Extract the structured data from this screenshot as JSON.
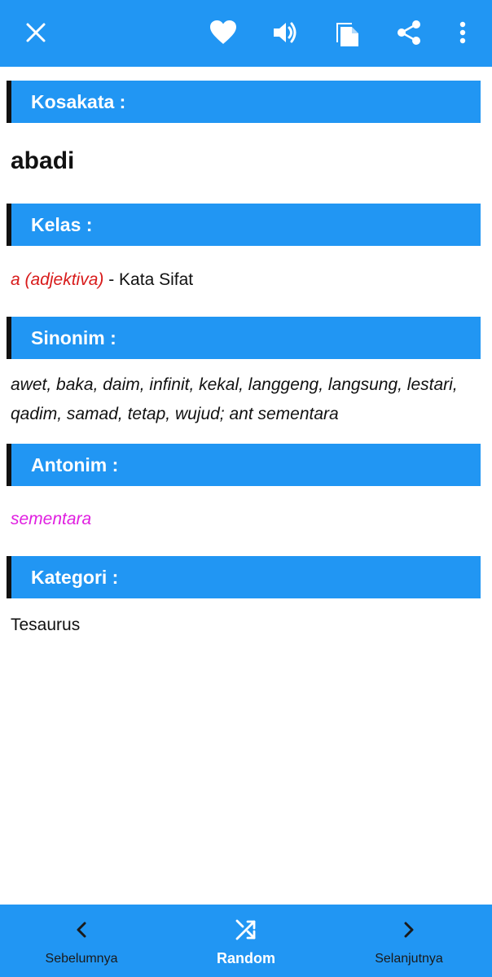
{
  "toolbar": {
    "icons": [
      "close-icon",
      "heart-icon",
      "volume-icon",
      "copy-icon",
      "share-icon",
      "more-vert-icon"
    ],
    "color": "#2196F3"
  },
  "sections": {
    "kosakata": {
      "header": "Kosakata :",
      "value": "abadi"
    },
    "kelas": {
      "header": "Kelas :",
      "class_abbr": "a (adjektiva)",
      "class_desc": " - Kata Sifat"
    },
    "sinonim": {
      "header": "Sinonim :",
      "value": "awet, baka, daim, infinit, kekal, langgeng, langsung, lestari, qadim, samad, tetap, wujud; ant sementara"
    },
    "antonim": {
      "header": "Antonim :",
      "value": "sementara"
    },
    "kategori": {
      "header": "Kategori :",
      "value": "Tesaurus"
    }
  },
  "bottom_nav": {
    "prev_label": "Sebelumnya",
    "random_label": "Random",
    "next_label": "Selanjutnya"
  },
  "colors": {
    "accent": "#2196F3",
    "class_red": "#d81b1b",
    "antonym_magenta": "#e020e0"
  }
}
